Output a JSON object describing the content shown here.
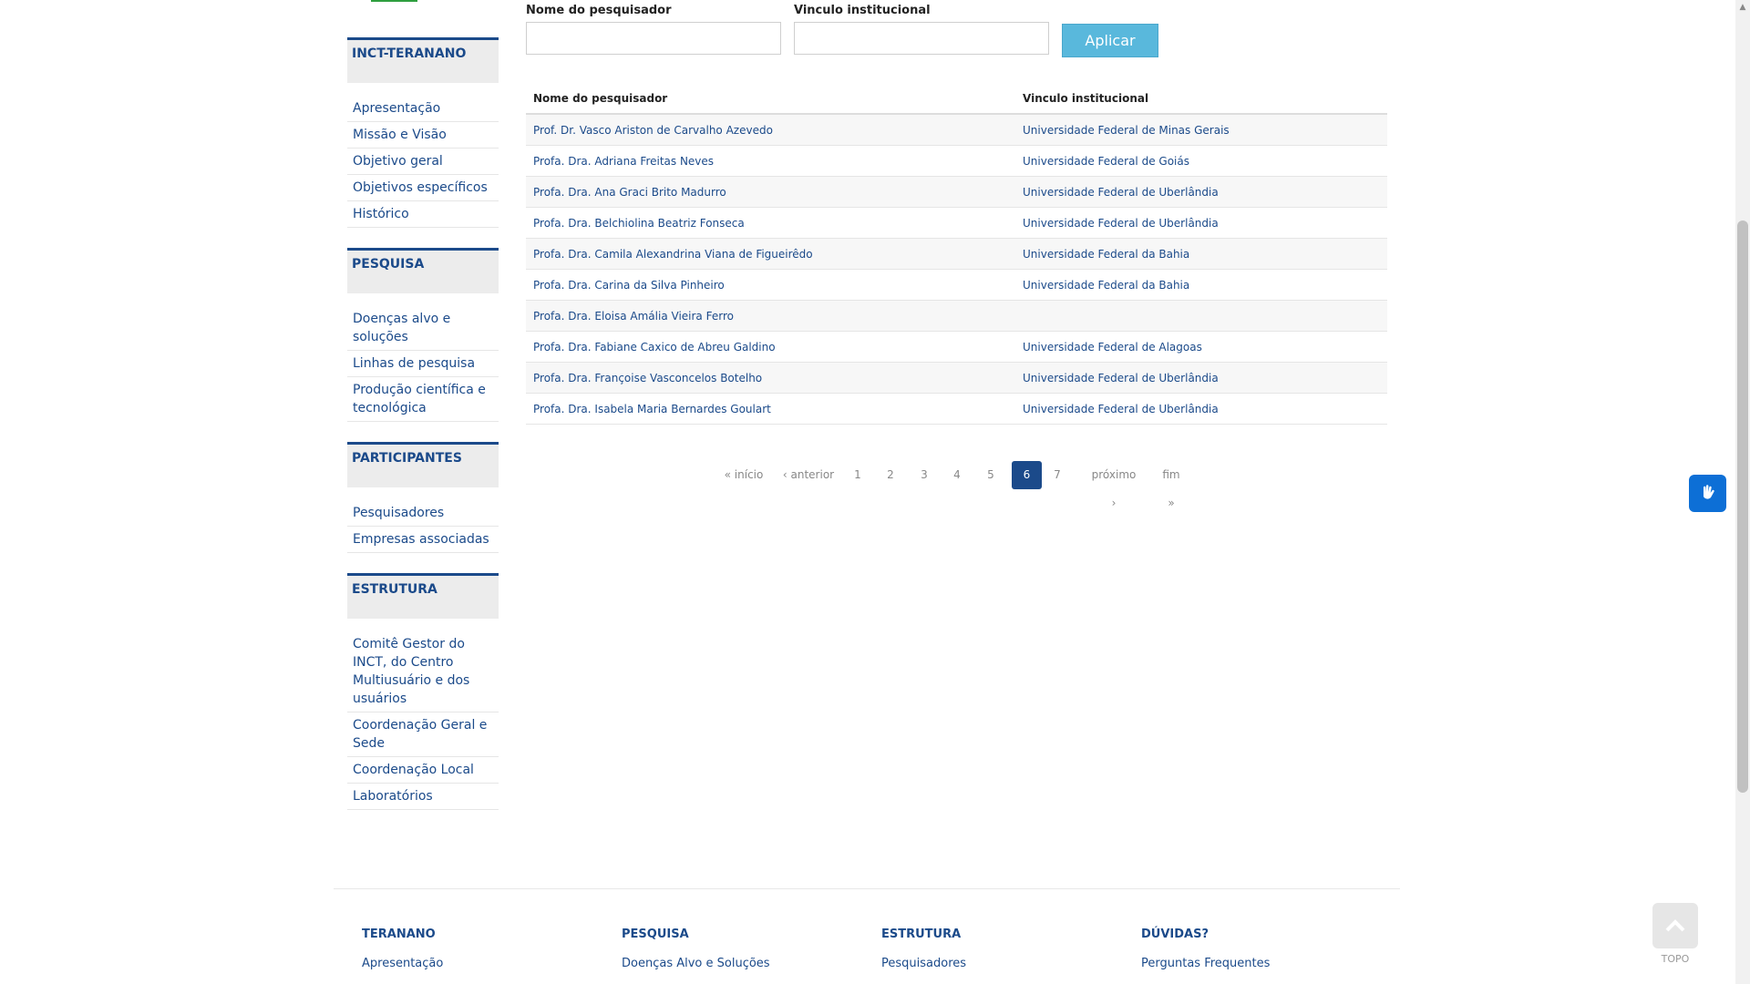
{
  "sidebar": {
    "sections": [
      {
        "title": "INCT-TERANANO",
        "items": [
          "Apresentação",
          "Missão e Visão",
          "Objetivo geral",
          "Objetivos específicos",
          "Histórico"
        ]
      },
      {
        "title": "PESQUISA",
        "items": [
          "Doenças alvo e soluções",
          "Linhas de pesquisa",
          "Produção científica e tecnológica"
        ]
      },
      {
        "title": "PARTICIPANTES",
        "items": [
          "Pesquisadores",
          "Empresas associadas"
        ]
      },
      {
        "title": "ESTRUTURA",
        "items": [
          "Comitê Gestor do INCT, do Centro Multiusuário e dos usuários",
          "Coordenação Geral e Sede",
          "Coordenação Local",
          "Laboratórios"
        ]
      }
    ]
  },
  "filters": {
    "name_label": "Nome do pesquisador",
    "name_value": "",
    "institution_label": "Vinculo institucional",
    "institution_value": "",
    "apply_label": "Aplicar"
  },
  "table": {
    "headers": [
      "Nome do pesquisador",
      "Vinculo institucional"
    ],
    "rows": [
      {
        "name": "Prof. Dr. Vasco Ariston de Carvalho Azevedo",
        "institution": "Universidade Federal de Minas Gerais"
      },
      {
        "name": "Profa. Dra. Adriana Freitas Neves",
        "institution": "Universidade Federal de Goiás"
      },
      {
        "name": "Profa. Dra. Ana Graci Brito Madurro",
        "institution": "Universidade Federal de Uberlândia"
      },
      {
        "name": "Profa. Dra. Belchiolina Beatriz Fonseca",
        "institution": "Universidade Federal de Uberlândia"
      },
      {
        "name": "Profa. Dra. Camila Alexandrina Viana de Figueirêdo",
        "institution": "Universidade Federal da Bahia"
      },
      {
        "name": "Profa. Dra. Carina da Silva Pinheiro",
        "institution": "Universidade Federal da Bahia"
      },
      {
        "name": "Profa. Dra. Eloisa Amália Vieira Ferro",
        "institution": ""
      },
      {
        "name": "Profa. Dra. Fabiane Caxico de Abreu Galdino",
        "institution": "Universidade Federal de Alagoas"
      },
      {
        "name": "Profa. Dra. Françoise Vasconcelos Botelho",
        "institution": "Universidade Federal de Uberlândia"
      },
      {
        "name": "Profa. Dra. Isabela Maria Bernardes Goulart",
        "institution": "Universidade Federal de Uberlândia"
      }
    ]
  },
  "pager": {
    "first": "« início",
    "prev": "‹ anterior",
    "pages": [
      "1",
      "2",
      "3",
      "4",
      "5",
      "6",
      "7"
    ],
    "current": "6",
    "next": "próximo ›",
    "last": "fim »"
  },
  "widgets": {
    "vlibras_icon": "hand-sign-icon",
    "topo_label": "TOPO"
  },
  "footer": {
    "columns": [
      {
        "title": "TERANANO",
        "links": [
          "Apresentação"
        ]
      },
      {
        "title": "PESQUISA",
        "links": [
          "Doenças Alvo e Soluções"
        ]
      },
      {
        "title": "ESTRUTURA",
        "links": [
          "Pesquisadores"
        ]
      },
      {
        "title": "DÚVIDAS?",
        "links": [
          "Perguntas Frequentes"
        ]
      }
    ]
  },
  "colors": {
    "brand": "#1b4a8a",
    "apply": "#59b8dc",
    "vlibras": "#0d6fd6"
  }
}
